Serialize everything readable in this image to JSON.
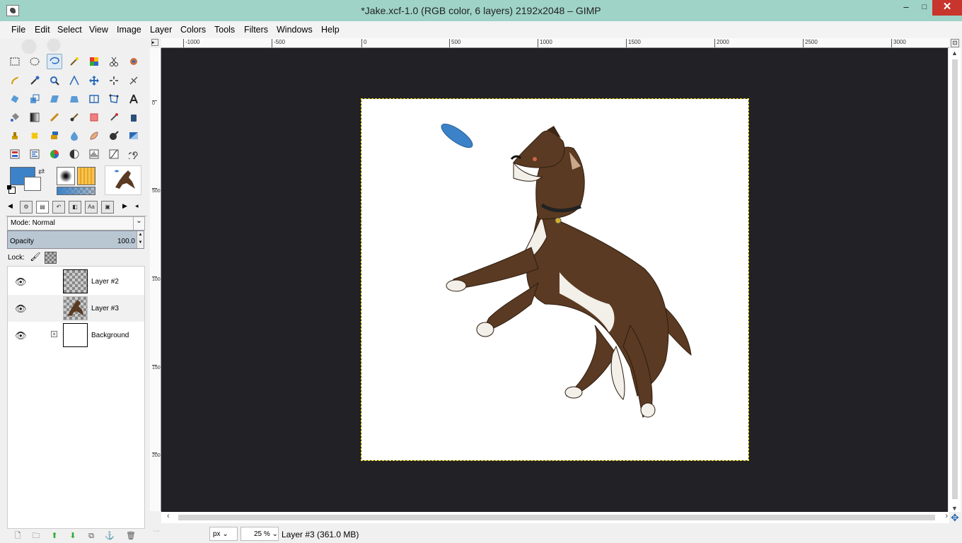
{
  "window": {
    "title": "*Jake.xcf-1.0 (RGB color, 6 layers) 2192x2048 – GIMP",
    "min": "‒",
    "max": "□",
    "close": "✕"
  },
  "menu": [
    "File",
    "Edit",
    "Select",
    "View",
    "Image",
    "Layer",
    "Colors",
    "Tools",
    "Filters",
    "Windows",
    "Help"
  ],
  "colors": {
    "foreground": "#3b82c8",
    "background": "#ffffff",
    "canvas_bg": "#222125",
    "titlebar": "#9fd3c7"
  },
  "layers_dock": {
    "mode_label": "Mode: Normal",
    "opacity_label": "Opacity",
    "opacity_value": "100.0",
    "lock_label": "Lock:",
    "layers": [
      {
        "name": "Layer #2"
      },
      {
        "name": "Layer #3"
      },
      {
        "name": "Background"
      }
    ]
  },
  "rulers": {
    "h": [
      "-1000",
      "-500",
      "0",
      "500",
      "1000",
      "1500",
      "2000",
      "2500",
      "3000"
    ],
    "v": [
      "0",
      "500",
      "1000",
      "1500",
      "2000"
    ]
  },
  "status": {
    "unit": "px",
    "zoom": "25 %",
    "text": "Layer #3 (361.0 MB)"
  }
}
